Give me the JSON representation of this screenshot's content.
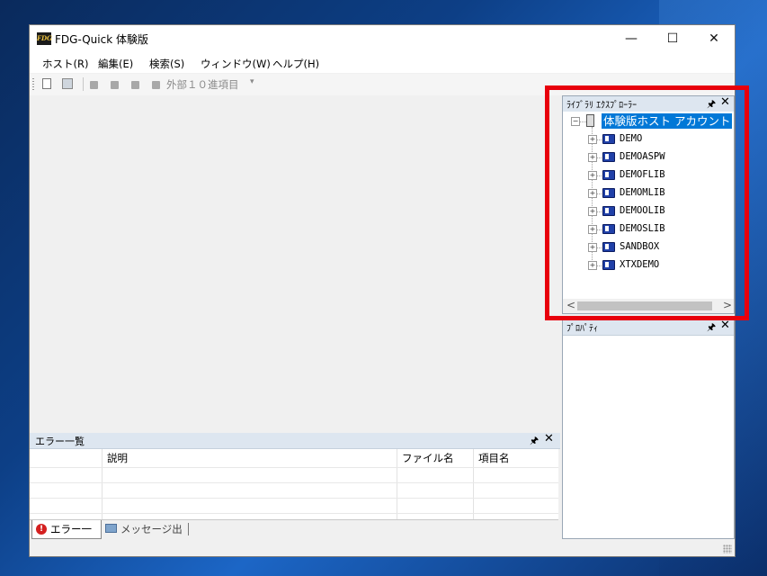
{
  "window": {
    "title": "FDG-Quick 体験版",
    "icon_name": "fdg-app-icon",
    "minimize": "—",
    "maximize": "☐",
    "close": "✕"
  },
  "menu": {
    "items": [
      "ホスト(R)",
      "編集(E)",
      "検索(S)",
      "ウィンドウ(W)",
      "ヘルプ(H)"
    ]
  },
  "toolbar": {
    "external_items_label": "外部１０進項目",
    "dropdown_glyph": "▾"
  },
  "error_panel": {
    "title": "エラー一覧",
    "pin": "ᵖ",
    "close": "✕",
    "columns": [
      "説明",
      "ファイル名",
      "項目名"
    ],
    "tabs": [
      "エラー一覧",
      "メッセージ出力"
    ]
  },
  "library_explorer": {
    "title": "ﾗｲﾌﾞﾗﾘ ｴｸｽﾌﾟﾛｰﾗｰ",
    "root_label": "体験版ホスト  アカウント",
    "libraries": [
      "DEMO",
      "DEMOASPW",
      "DEMOFLIB",
      "DEMOMLIB",
      "DEMOOLIB",
      "DEMOSLIB",
      "SANDBOX",
      "XTXDEMO"
    ],
    "scroll_left": "<",
    "scroll_right": ">"
  },
  "properties_panel": {
    "title": "ﾌﾟﾛﾊﾟﾃｨ"
  },
  "colors": {
    "highlight": "#e8000c",
    "selection": "#0078d7",
    "panel_header": "#dde6f0"
  }
}
